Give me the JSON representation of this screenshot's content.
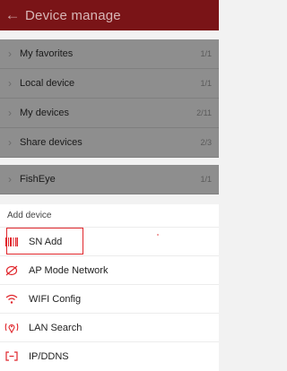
{
  "header": {
    "title": "Device manage",
    "back_icon": "arrow-left-icon"
  },
  "device_groups": [
    {
      "label": "My favorites",
      "count": "1/1"
    },
    {
      "label": "Local device",
      "count": "1/1"
    },
    {
      "label": "My devices",
      "count": "2/11"
    },
    {
      "label": "Share devices",
      "count": "2/3"
    }
  ],
  "fisheye": {
    "label": "FishEye",
    "count": "1/1"
  },
  "add_sheet": {
    "title": "Add device",
    "options": [
      {
        "label": "SN Add",
        "icon": "barcode-icon"
      },
      {
        "label": "AP Mode Network",
        "icon": "ap-mode-icon"
      },
      {
        "label": "WIFI Config",
        "icon": "wifi-icon"
      },
      {
        "label": "LAN Search",
        "icon": "location-pin-icon"
      },
      {
        "label": "IP/DDNS",
        "icon": "ip-plug-icon"
      }
    ]
  },
  "colors": {
    "header_bg": "#7a1417",
    "accent": "#e0262c",
    "overlay_row": "#8e8e8e"
  }
}
